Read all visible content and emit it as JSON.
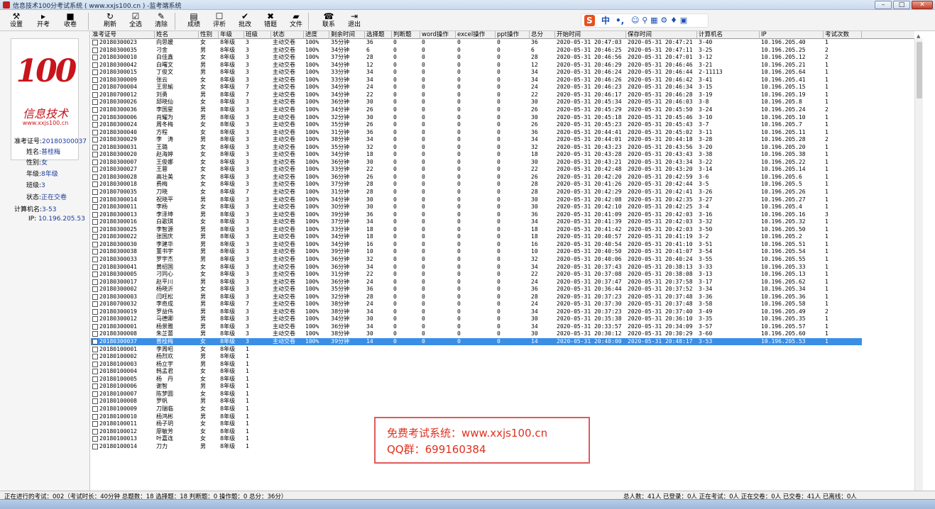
{
  "window": {
    "title": "信息技术100分考试系统 ( www.xxjs100.cn ) -监考端系统",
    "min": "–",
    "max": "□",
    "close": "✕"
  },
  "toolbar": [
    {
      "name": "settings-button",
      "icon": "⚒",
      "label": "设置"
    },
    {
      "name": "start-exam-button",
      "icon": "▸",
      "label": "开考"
    },
    {
      "name": "collect-button",
      "icon": "■",
      "label": "收卷"
    },
    {
      "name": "refresh-button",
      "icon": "↻",
      "label": "刷新"
    },
    {
      "name": "select-all-button",
      "icon": "☑",
      "label": "全选"
    },
    {
      "name": "clear-button",
      "icon": "✎",
      "label": "清除"
    },
    {
      "name": "scores-button",
      "icon": "▤",
      "label": "成绩"
    },
    {
      "name": "analysis-button",
      "icon": "☐",
      "label": "评析"
    },
    {
      "name": "batch-grade-button",
      "icon": "✔",
      "label": "批改"
    },
    {
      "name": "wrong-questions-button",
      "icon": "✖",
      "label": "错题"
    },
    {
      "name": "files-button",
      "icon": "▰",
      "label": "文件"
    },
    {
      "name": "contact-button",
      "icon": "☎",
      "label": "联系"
    },
    {
      "name": "exit-button",
      "icon": "⇥",
      "label": "退出"
    }
  ],
  "ime": {
    "brand": "S",
    "mode": "中",
    "punct": "•,",
    "icons": "☺ ⚲ ▦ ⚙ ♦ ▣"
  },
  "logo": {
    "number": "100",
    "calligraphy": "信息技术",
    "url": "www.xxjs100.cn"
  },
  "student": {
    "id_label": "准考证号:",
    "id": "20180300037",
    "name_label": "姓名:",
    "name": "普桂梅",
    "gender_label": "性别:",
    "gender": "女",
    "grade_label": "年级:",
    "grade": "8年级",
    "class_label": "班级:",
    "class": "3",
    "status_label": "状态:",
    "status": "正在交卷",
    "pc_label": "计算机名:",
    "pc": "3-53",
    "ip_label": "IP:",
    "ip": "10.196.205.53"
  },
  "columns": [
    "准考证号",
    "姓名",
    "性别",
    "年级",
    "班级",
    "状态",
    "进度",
    "剩余时间",
    "选择题",
    "判断题",
    "word操作",
    "excel操作",
    "ppt操作",
    "总分",
    "开始时间",
    "保存时间",
    "计算机名",
    "IP",
    "考试次数"
  ],
  "rows": [
    [
      "20180300023",
      "向思媛",
      "女",
      "8年级",
      "3",
      "主动交卷",
      "100%",
      "35分钟",
      "36",
      "0",
      "0",
      "0",
      "0",
      "36",
      "2020-05-31 20:47:03",
      "2020-05-31 20:47:21",
      "3-40",
      "10.196.205.40",
      "1"
    ],
    [
      "20180300035",
      "刁金",
      "男",
      "8年级",
      "3",
      "主动交卷",
      "100%",
      "34分钟",
      "6",
      "0",
      "0",
      "0",
      "0",
      "6",
      "2020-05-31 20:46:25",
      "2020-05-31 20:47:11",
      "3-25",
      "10.196.205.25",
      "2"
    ],
    [
      "20180300010",
      "白佳鑫",
      "女",
      "8年级",
      "3",
      "主动交卷",
      "100%",
      "37分钟",
      "28",
      "0",
      "0",
      "0",
      "0",
      "28",
      "2020-05-31 20:46:56",
      "2020-05-31 20:47:01",
      "3-12",
      "10.196.205.12",
      "2"
    ],
    [
      "20180300042",
      "白曙文",
      "男",
      "8年级",
      "3",
      "主动交卷",
      "100%",
      "34分钟",
      "12",
      "0",
      "0",
      "0",
      "0",
      "12",
      "2020-05-31 20:46:29",
      "2020-05-31 20:46:46",
      "3-21",
      "10.196.205.21",
      "1"
    ],
    [
      "20180300015",
      "丁俊文",
      "男",
      "8年级",
      "3",
      "主动交卷",
      "100%",
      "33分钟",
      "34",
      "0",
      "0",
      "0",
      "0",
      "34",
      "2020-05-31 20:46:24",
      "2020-05-31 20:46:44",
      "2-11113",
      "10.196.205.64",
      "1"
    ],
    [
      "20180300009",
      "张云",
      "女",
      "8年级",
      "3",
      "主动交卷",
      "100%",
      "33分钟",
      "34",
      "0",
      "0",
      "0",
      "0",
      "34",
      "2020-05-31 20:46:26",
      "2020-05-31 20:46:42",
      "3-41",
      "10.196.205.41",
      "1"
    ],
    [
      "20180700004",
      "王思瑜",
      "女",
      "8年级",
      "7",
      "主动交卷",
      "100%",
      "34分钟",
      "24",
      "0",
      "0",
      "0",
      "0",
      "24",
      "2020-05-31 20:46:23",
      "2020-05-31 20:46:34",
      "3-15",
      "10.196.205.15",
      "1"
    ],
    [
      "20180700012",
      "刘勇",
      "男",
      "8年级",
      "7",
      "主动交卷",
      "100%",
      "34分钟",
      "22",
      "0",
      "0",
      "0",
      "0",
      "22",
      "2020-05-31 20:46:17",
      "2020-05-31 20:46:28",
      "3-19",
      "10.196.205.19",
      "1"
    ],
    [
      "20180300026",
      "邱晓仙",
      "女",
      "8年级",
      "3",
      "主动交卷",
      "100%",
      "36分钟",
      "30",
      "0",
      "0",
      "0",
      "0",
      "30",
      "2020-05-31 20:45:34",
      "2020-05-31 20:46:03",
      "3-8",
      "10.196.205.8",
      "1"
    ],
    [
      "20180300036",
      "李国星",
      "男",
      "8年级",
      "3",
      "主动交卷",
      "100%",
      "34分钟",
      "26",
      "0",
      "0",
      "0",
      "0",
      "26",
      "2020-05-31 20:45:29",
      "2020-05-31 20:45:50",
      "3-24",
      "10.196.205.24",
      "2"
    ],
    [
      "20180300006",
      "肖耀为",
      "男",
      "8年级",
      "3",
      "主动交卷",
      "100%",
      "32分钟",
      "30",
      "0",
      "0",
      "0",
      "0",
      "30",
      "2020-05-31 20:45:18",
      "2020-05-31 20:45:46",
      "3-10",
      "10.196.205.10",
      "1"
    ],
    [
      "20180300024",
      "周冬梅",
      "女",
      "8年级",
      "3",
      "主动交卷",
      "100%",
      "35分钟",
      "26",
      "0",
      "0",
      "0",
      "0",
      "26",
      "2020-05-31 20:45:23",
      "2020-05-31 20:45:43",
      "3-7",
      "10.196.205.7",
      "1"
    ],
    [
      "20180300040",
      "方程",
      "女",
      "8年级",
      "3",
      "主动交卷",
      "100%",
      "31分钟",
      "36",
      "0",
      "0",
      "0",
      "0",
      "36",
      "2020-05-31 20:44:41",
      "2020-05-31 20:45:02",
      "3-11",
      "10.196.205.11",
      "1"
    ],
    [
      "20180300029",
      "李　涛",
      "男",
      "8年级",
      "3",
      "主动交卷",
      "100%",
      "38分钟",
      "34",
      "0",
      "0",
      "0",
      "0",
      "34",
      "2020-05-31 20:44:01",
      "2020-05-31 20:44:18",
      "3-28",
      "10.196.205.28",
      "2"
    ],
    [
      "20180300031",
      "王璐",
      "女",
      "8年级",
      "3",
      "主动交卷",
      "100%",
      "35分钟",
      "32",
      "0",
      "0",
      "0",
      "0",
      "32",
      "2020-05-31 20:43:23",
      "2020-05-31 20:43:56",
      "3-20",
      "10.196.205.20",
      "1"
    ],
    [
      "20180300020",
      "赵海婷",
      "女",
      "8年级",
      "3",
      "主动交卷",
      "100%",
      "34分钟",
      "18",
      "0",
      "0",
      "0",
      "0",
      "18",
      "2020-05-31 20:43:28",
      "2020-05-31 20:43:43",
      "3-38",
      "10.196.205.38",
      "1"
    ],
    [
      "20180300007",
      "王俊娜",
      "女",
      "8年级",
      "3",
      "主动交卷",
      "100%",
      "36分钟",
      "30",
      "0",
      "0",
      "0",
      "0",
      "30",
      "2020-05-31 20:43:21",
      "2020-05-31 20:43:34",
      "3-22",
      "10.196.205.22",
      "1"
    ],
    [
      "20180300027",
      "王蓉",
      "女",
      "8年级",
      "3",
      "主动交卷",
      "100%",
      "33分钟",
      "22",
      "0",
      "0",
      "0",
      "0",
      "22",
      "2020-05-31 20:42:48",
      "2020-05-31 20:43:20",
      "3-14",
      "10.196.205.14",
      "1"
    ],
    [
      "20180300028",
      "高壮美",
      "女",
      "8年级",
      "3",
      "主动交卷",
      "100%",
      "36分钟",
      "26",
      "0",
      "0",
      "0",
      "0",
      "26",
      "2020-05-31 20:42:20",
      "2020-05-31 20:42:59",
      "3-6",
      "10.196.205.6",
      "1"
    ],
    [
      "20180300018",
      "费梅",
      "女",
      "8年级",
      "3",
      "主动交卷",
      "100%",
      "37分钟",
      "28",
      "0",
      "0",
      "0",
      "0",
      "28",
      "2020-05-31 20:41:26",
      "2020-05-31 20:42:44",
      "3-5",
      "10.196.205.5",
      "1"
    ],
    [
      "20180700035",
      "刀晓",
      "女",
      "8年级",
      "7",
      "主动交卷",
      "100%",
      "31分钟",
      "28",
      "0",
      "0",
      "0",
      "0",
      "28",
      "2020-05-31 20:42:29",
      "2020-05-31 20:42:41",
      "3-26",
      "10.196.205.26",
      "1"
    ],
    [
      "20180300014",
      "祝晓平",
      "男",
      "8年级",
      "3",
      "主动交卷",
      "100%",
      "34分钟",
      "30",
      "0",
      "0",
      "0",
      "0",
      "30",
      "2020-05-31 20:42:08",
      "2020-05-31 20:42:35",
      "3-27",
      "10.196.205.27",
      "1"
    ],
    [
      "20180300011",
      "李杨",
      "女",
      "8年级",
      "3",
      "主动交卷",
      "100%",
      "30分钟",
      "30",
      "0",
      "0",
      "0",
      "0",
      "30",
      "2020-05-31 20:42:10",
      "2020-05-31 20:42:25",
      "3-4",
      "10.196.205.4",
      "1"
    ],
    [
      "20180300013",
      "李泽坤",
      "男",
      "8年级",
      "3",
      "主动交卷",
      "100%",
      "39分钟",
      "36",
      "0",
      "0",
      "0",
      "0",
      "36",
      "2020-05-31 20:41:09",
      "2020-05-31 20:42:03",
      "3-16",
      "10.196.205.16",
      "3"
    ],
    [
      "20180300016",
      "白歌琪",
      "女",
      "8年级",
      "3",
      "主动交卷",
      "100%",
      "37分钟",
      "34",
      "0",
      "0",
      "0",
      "0",
      "34",
      "2020-05-31 20:41:39",
      "2020-05-31 20:42:03",
      "3-32",
      "10.196.205.32",
      "1"
    ],
    [
      "20180300025",
      "李智源",
      "男",
      "8年级",
      "3",
      "主动交卷",
      "100%",
      "33分钟",
      "18",
      "0",
      "0",
      "0",
      "0",
      "18",
      "2020-05-31 20:41:42",
      "2020-05-31 20:42:03",
      "3-50",
      "10.196.205.50",
      "1"
    ],
    [
      "20180300022",
      "张国庆",
      "男",
      "8年级",
      "3",
      "主动交卷",
      "100%",
      "34分钟",
      "18",
      "0",
      "0",
      "0",
      "0",
      "18",
      "2020-05-31 20:40:57",
      "2020-05-31 20:41:19",
      "3-2",
      "10.196.205.2",
      "1"
    ],
    [
      "20180300030",
      "李建华",
      "男",
      "8年级",
      "3",
      "主动交卷",
      "100%",
      "34分钟",
      "16",
      "0",
      "0",
      "0",
      "0",
      "16",
      "2020-05-31 20:40:54",
      "2020-05-31 20:41:10",
      "3-51",
      "10.196.205.51",
      "1"
    ],
    [
      "20180300038",
      "董书宇",
      "男",
      "8年级",
      "3",
      "主动交卷",
      "100%",
      "39分钟",
      "10",
      "0",
      "0",
      "0",
      "0",
      "10",
      "2020-05-31 20:40:50",
      "2020-05-31 20:41:07",
      "3-54",
      "10.196.205.54",
      "1"
    ],
    [
      "20180300033",
      "罗宇杰",
      "男",
      "8年级",
      "3",
      "主动交卷",
      "100%",
      "36分钟",
      "32",
      "0",
      "0",
      "0",
      "0",
      "32",
      "2020-05-31 20:40:06",
      "2020-05-31 20:40:24",
      "3-55",
      "10.196.205.55",
      "1"
    ],
    [
      "20180300041",
      "黄绍国",
      "女",
      "8年级",
      "3",
      "主动交卷",
      "100%",
      "36分钟",
      "34",
      "0",
      "0",
      "0",
      "0",
      "34",
      "2020-05-31 20:37:43",
      "2020-05-31 20:38:13",
      "3-33",
      "10.196.205.33",
      "1"
    ],
    [
      "20180300005",
      "刁同心",
      "女",
      "8年级",
      "3",
      "主动交卷",
      "100%",
      "31分钟",
      "22",
      "0",
      "0",
      "0",
      "0",
      "22",
      "2020-05-31 20:37:08",
      "2020-05-31 20:38:08",
      "3-13",
      "10.196.205.13",
      "1"
    ],
    [
      "20180300017",
      "赵平川",
      "男",
      "8年级",
      "3",
      "主动交卷",
      "100%",
      "36分钟",
      "24",
      "0",
      "0",
      "0",
      "0",
      "24",
      "2020-05-31 20:37:47",
      "2020-05-31 20:37:58",
      "3-17",
      "10.196.205.62",
      "1"
    ],
    [
      "20180300002",
      "杨晓沂",
      "女",
      "8年级",
      "3",
      "主动交卷",
      "100%",
      "35分钟",
      "36",
      "0",
      "0",
      "0",
      "0",
      "36",
      "2020-05-31 20:36:44",
      "2020-05-31 20:37:52",
      "3-34",
      "10.196.205.34",
      "1"
    ],
    [
      "20180300003",
      "闫旺松",
      "男",
      "8年级",
      "3",
      "主动交卷",
      "100%",
      "32分钟",
      "28",
      "0",
      "0",
      "0",
      "0",
      "28",
      "2020-05-31 20:37:23",
      "2020-05-31 20:37:48",
      "3-36",
      "10.196.205.36",
      "1"
    ],
    [
      "20180700032",
      "李奇成",
      "男",
      "8年级",
      "7",
      "主动交卷",
      "100%",
      "38分钟",
      "24",
      "0",
      "0",
      "0",
      "0",
      "24",
      "2020-05-31 20:37:30",
      "2020-05-31 20:37:48",
      "3-58",
      "10.196.205.58",
      "1"
    ],
    [
      "20180300019",
      "罗益伟",
      "男",
      "8年级",
      "3",
      "主动交卷",
      "100%",
      "38分钟",
      "34",
      "0",
      "0",
      "0",
      "0",
      "34",
      "2020-05-31 20:37:23",
      "2020-05-31 20:37:40",
      "3-49",
      "10.196.205.49",
      "2"
    ],
    [
      "20180300012",
      "马德卿",
      "男",
      "8年级",
      "3",
      "主动交卷",
      "100%",
      "34分钟",
      "30",
      "0",
      "0",
      "0",
      "0",
      "30",
      "2020-05-31 20:35:38",
      "2020-05-31 20:36:10",
      "3-35",
      "10.196.205.35",
      "1"
    ],
    [
      "20180300001",
      "杨景雅",
      "男",
      "8年级",
      "3",
      "主动交卷",
      "100%",
      "36分钟",
      "34",
      "0",
      "0",
      "0",
      "0",
      "34",
      "2020-05-31 20:33:57",
      "2020-05-31 20:34:09",
      "3-57",
      "10.196.205.57",
      "1"
    ],
    [
      "20180300008",
      "朱芷蕾",
      "男",
      "8年级",
      "3",
      "主动交卷",
      "100%",
      "38分钟",
      "30",
      "0",
      "0",
      "0",
      "0",
      "30",
      "2020-05-31 20:30:12",
      "2020-05-31 20:30:29",
      "3-60",
      "10.196.205.60",
      "1"
    ],
    [
      "20180300037",
      "普桂梅",
      "女",
      "8年级",
      "3",
      "主动交卷",
      "100%",
      "39分钟",
      "14",
      "0",
      "0",
      "0",
      "0",
      "14",
      "2020-05-31 20:48:00",
      "2020-05-31 20:48:17",
      "3-53",
      "10.196.205.53",
      "1"
    ],
    [
      "20180100001",
      "李周昭",
      "女",
      "8年级",
      "1",
      "",
      "",
      "",
      "",
      "",
      "",
      "",
      "",
      "",
      "",
      "",
      "",
      "",
      ""
    ],
    [
      "20180100002",
      "杨烈欢",
      "男",
      "8年级",
      "1",
      "",
      "",
      "",
      "",
      "",
      "",
      "",
      "",
      "",
      "",
      "",
      "",
      "",
      ""
    ],
    [
      "20180100003",
      "杨立宇",
      "男",
      "8年级",
      "1",
      "",
      "",
      "",
      "",
      "",
      "",
      "",
      "",
      "",
      "",
      "",
      "",
      "",
      ""
    ],
    [
      "20180100004",
      "韩孟君",
      "女",
      "8年级",
      "1",
      "",
      "",
      "",
      "",
      "",
      "",
      "",
      "",
      "",
      "",
      "",
      "",
      "",
      ""
    ],
    [
      "20180100005",
      "杨　丹",
      "女",
      "8年级",
      "1",
      "",
      "",
      "",
      "",
      "",
      "",
      "",
      "",
      "",
      "",
      "",
      "",
      "",
      ""
    ],
    [
      "20180100006",
      "谢智",
      "男",
      "8年级",
      "1",
      "",
      "",
      "",
      "",
      "",
      "",
      "",
      "",
      "",
      "",
      "",
      "",
      "",
      ""
    ],
    [
      "20180100007",
      "陈梦圆",
      "女",
      "8年级",
      "1",
      "",
      "",
      "",
      "",
      "",
      "",
      "",
      "",
      "",
      "",
      "",
      "",
      "",
      ""
    ],
    [
      "20180100008",
      "罗帆",
      "男",
      "8年级",
      "1",
      "",
      "",
      "",
      "",
      "",
      "",
      "",
      "",
      "",
      "",
      "",
      "",
      "",
      ""
    ],
    [
      "20180100009",
      "刀瑞临",
      "女",
      "8年级",
      "1",
      "",
      "",
      "",
      "",
      "",
      "",
      "",
      "",
      "",
      "",
      "",
      "",
      "",
      ""
    ],
    [
      "20180100010",
      "杨鸿彬",
      "男",
      "8年级",
      "1",
      "",
      "",
      "",
      "",
      "",
      "",
      "",
      "",
      "",
      "",
      "",
      "",
      "",
      ""
    ],
    [
      "20180100011",
      "杨子玥",
      "女",
      "8年级",
      "1",
      "",
      "",
      "",
      "",
      "",
      "",
      "",
      "",
      "",
      "",
      "",
      "",
      "",
      ""
    ],
    [
      "20180100012",
      "廖敏芳",
      "女",
      "8年级",
      "1",
      "",
      "",
      "",
      "",
      "",
      "",
      "",
      "",
      "",
      "",
      "",
      "",
      "",
      ""
    ],
    [
      "20180100013",
      "叶嘉连",
      "女",
      "8年级",
      "1",
      "",
      "",
      "",
      "",
      "",
      "",
      "",
      "",
      "",
      "",
      "",
      "",
      "",
      ""
    ],
    [
      "20180100014",
      "刀力",
      "男",
      "8年级",
      "1",
      "",
      "",
      "",
      "",
      "",
      "",
      "",
      "",
      "",
      "",
      "",
      "",
      "",
      ""
    ]
  ],
  "selected_row": 40,
  "promo": {
    "line1": "免费考试系统：www.xxjs100.cn",
    "line2": "QQ群：699160384"
  },
  "status": {
    "left": "正在进行的考试：002（考试时长：40分钟 总题数：18 选择题：18 判断题：0 操作题：0 总分：36分）",
    "right": "总人数：41人  已登录：0人  正在考试：0人  正在交卷：0人  已交卷：41人  已离线：0人"
  },
  "colors": {
    "selection": "#3a8ee6",
    "accent_red": "#c8141c",
    "info_blue": "#1a3a9a"
  }
}
